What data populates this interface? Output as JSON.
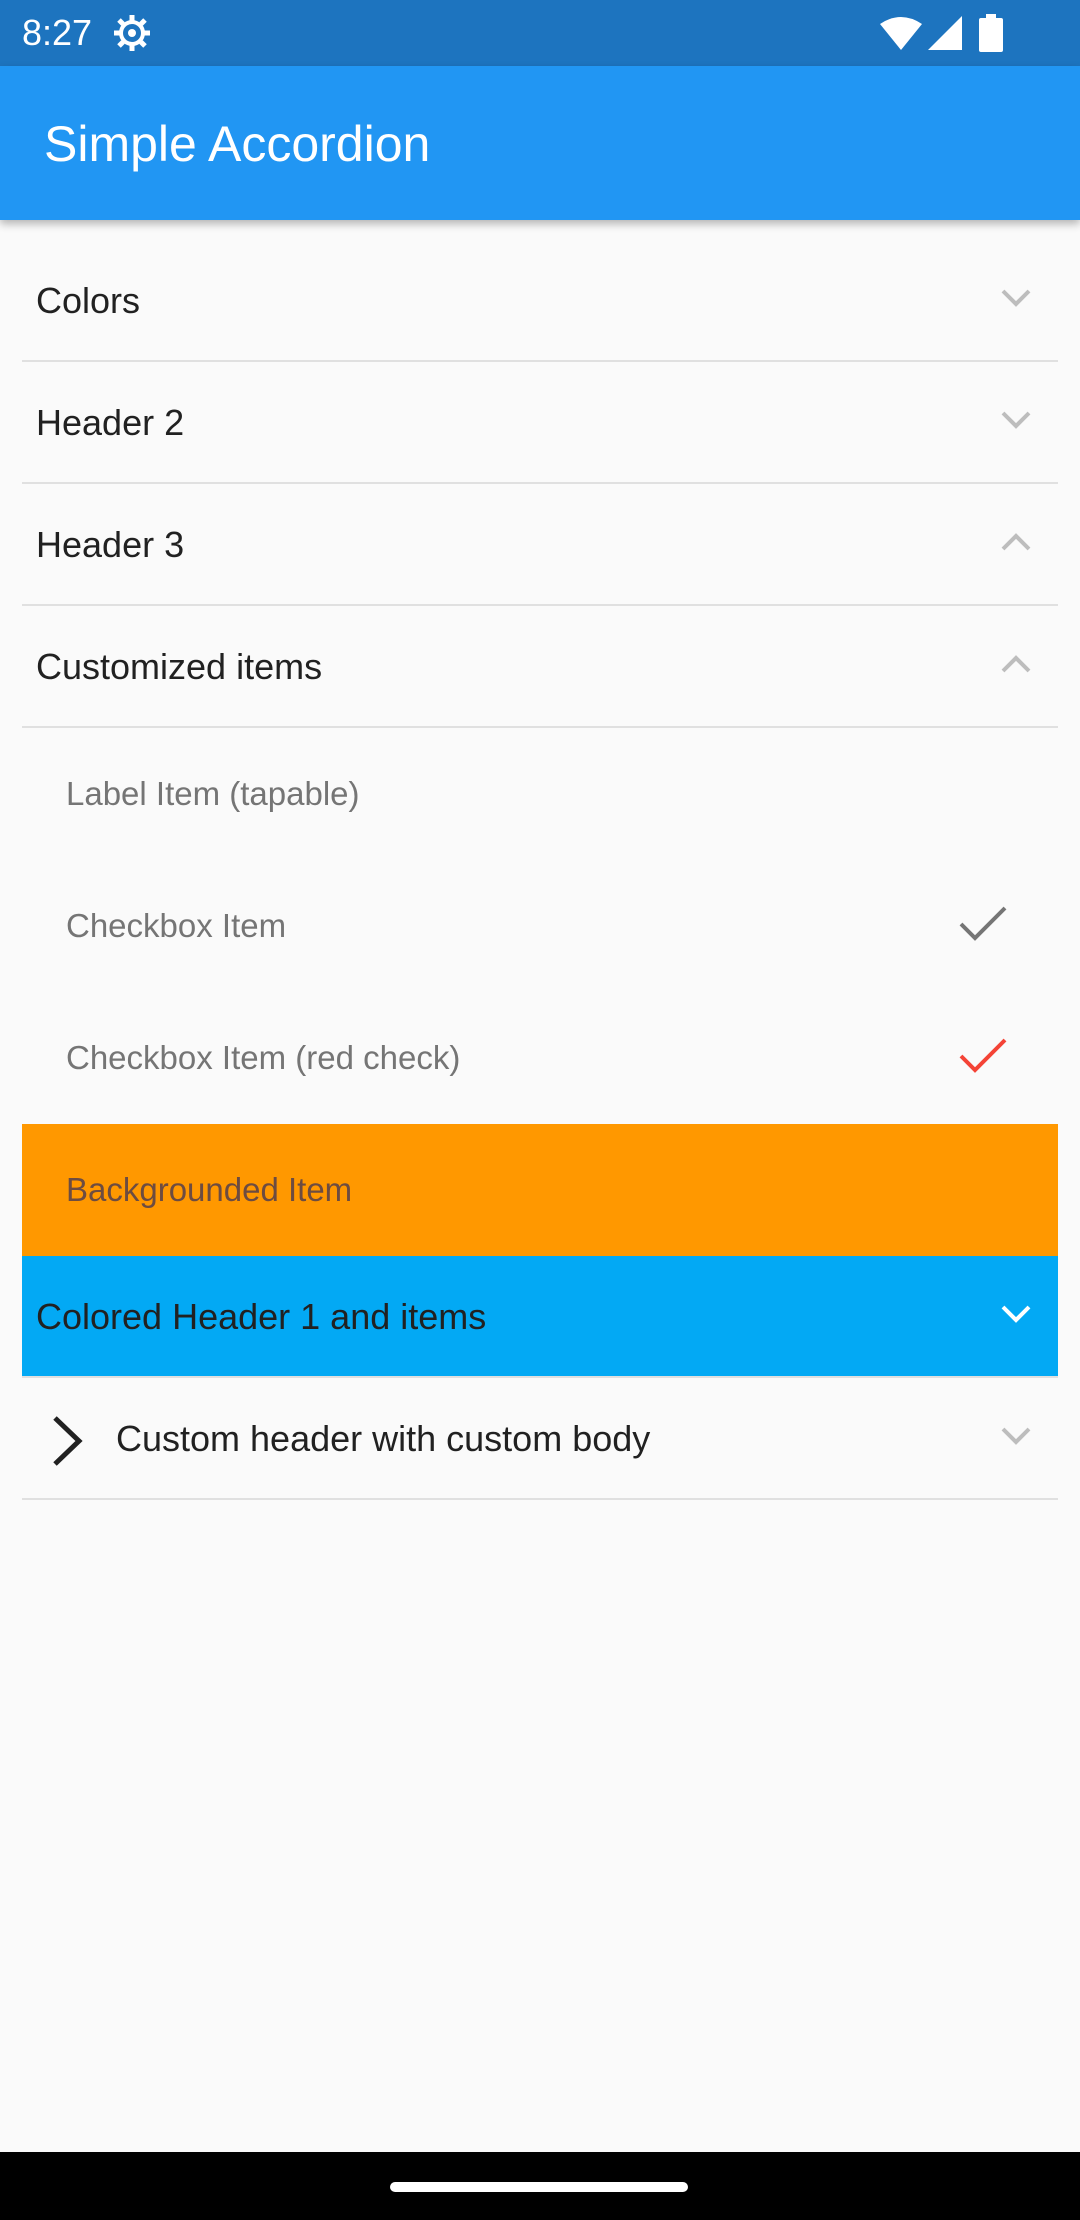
{
  "status_bar": {
    "time": "8:27",
    "icons": [
      "settings-gear-icon",
      "wifi-icon",
      "cell-signal-icon",
      "battery-icon"
    ]
  },
  "app_bar": {
    "title": "Simple Accordion",
    "color": "#2196f3"
  },
  "accordion": {
    "sections": [
      {
        "label": "Colors",
        "state": "collapsed",
        "icon": "chevron-down-icon"
      },
      {
        "label": "Header 2",
        "state": "collapsed",
        "icon": "chevron-down-icon"
      },
      {
        "label": "Header 3",
        "state": "expanded",
        "icon": "chevron-up-icon"
      },
      {
        "label": "Customized items",
        "state": "expanded",
        "icon": "chevron-up-icon",
        "items": [
          {
            "label": "Label Item (tapable)"
          },
          {
            "label": "Checkbox Item",
            "checked": true,
            "check_color": "#757575",
            "icon": "checkmark-icon"
          },
          {
            "label": "Checkbox Item (red check)",
            "checked": true,
            "check_color": "#f44336",
            "icon": "checkmark-icon"
          },
          {
            "label": "Backgrounded Item",
            "background": "#ff9800"
          }
        ]
      },
      {
        "label": "Colored Header 1 and items",
        "state": "collapsed",
        "background": "#03a9f4",
        "icon": "chevron-down-icon"
      },
      {
        "label": "Custom header with custom body",
        "state": "collapsed",
        "leading_icon": "chevron-right-icon",
        "icon": "chevron-down-icon"
      }
    ]
  }
}
